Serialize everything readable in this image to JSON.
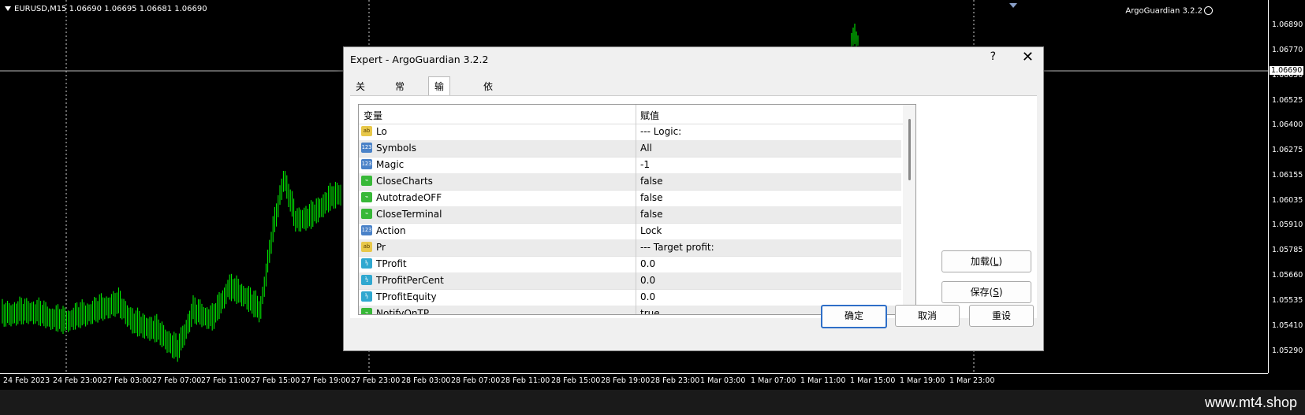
{
  "chart": {
    "title_label": "EURUSD,M15  1.06690 1.06695 1.06681 1.06690",
    "ea_label": "ArgoGuardian 3.2.2",
    "current_price": "1.06690",
    "price_ticks": [
      "1.06890",
      "1.06770",
      "1.06650",
      "1.06525",
      "1.06400",
      "1.06275",
      "1.06155",
      "1.06035",
      "1.05910",
      "1.05785",
      "1.05660",
      "1.05535",
      "1.05410",
      "1.05290"
    ],
    "time_ticks": [
      "24 Feb 2023",
      "24 Feb 23:00",
      "27 Feb 03:00",
      "27 Feb 07:00",
      "27 Feb 11:00",
      "27 Feb 15:00",
      "27 Feb 19:00",
      "27 Feb 23:00",
      "28 Feb 03:00",
      "28 Feb 07:00",
      "28 Feb 11:00",
      "28 Feb 15:00",
      "28 Feb 19:00",
      "28 Feb 23:00",
      "1 Mar 03:00",
      "1 Mar 07:00",
      "1 Mar 11:00",
      "1 Mar 15:00",
      "1 Mar 19:00",
      "1 Mar 23:00"
    ],
    "candle_color": "#00ff00"
  },
  "footer": {
    "brand": "www.mt4.shop"
  },
  "dialog": {
    "title": "Expert - ArgoGuardian 3.2.2",
    "help_label": "?",
    "close_label": "✕",
    "tabs": [
      {
        "label": "关于"
      },
      {
        "label": "常用"
      },
      {
        "label": "输入参数"
      },
      {
        "label": "依存关系"
      }
    ],
    "grid": {
      "col_variable": "变量",
      "col_value": "赋值",
      "rows": [
        {
          "icon": "ab",
          "var": "Lo",
          "val": "--- Logic:"
        },
        {
          "icon": "123",
          "var": "Symbols",
          "val": "All"
        },
        {
          "icon": "123",
          "var": "Magic",
          "val": "-1"
        },
        {
          "icon": "bool",
          "var": "CloseCharts",
          "val": "false"
        },
        {
          "icon": "bool",
          "var": "AutotradeOFF",
          "val": "false"
        },
        {
          "icon": "bool",
          "var": "CloseTerminal",
          "val": "false"
        },
        {
          "icon": "123",
          "var": "Action",
          "val": "Lock"
        },
        {
          "icon": "ab",
          "var": "Pr",
          "val": "--- Target profit:"
        },
        {
          "icon": "v2",
          "var": "TProfit",
          "val": "0.0"
        },
        {
          "icon": "v2",
          "var": "TProfitPerCent",
          "val": "0.0"
        },
        {
          "icon": "v2",
          "var": "TProfitEquity",
          "val": "0.0"
        },
        {
          "icon": "bool",
          "var": "NotifyOnTP",
          "val": "true"
        }
      ]
    },
    "load_button": {
      "pre": "加载(",
      "key": "L",
      "post": ")"
    },
    "save_button": {
      "pre": "保存(",
      "key": "S",
      "post": ")"
    },
    "ok_label": "确定",
    "cancel_label": "取消",
    "reset_label": "重设"
  }
}
